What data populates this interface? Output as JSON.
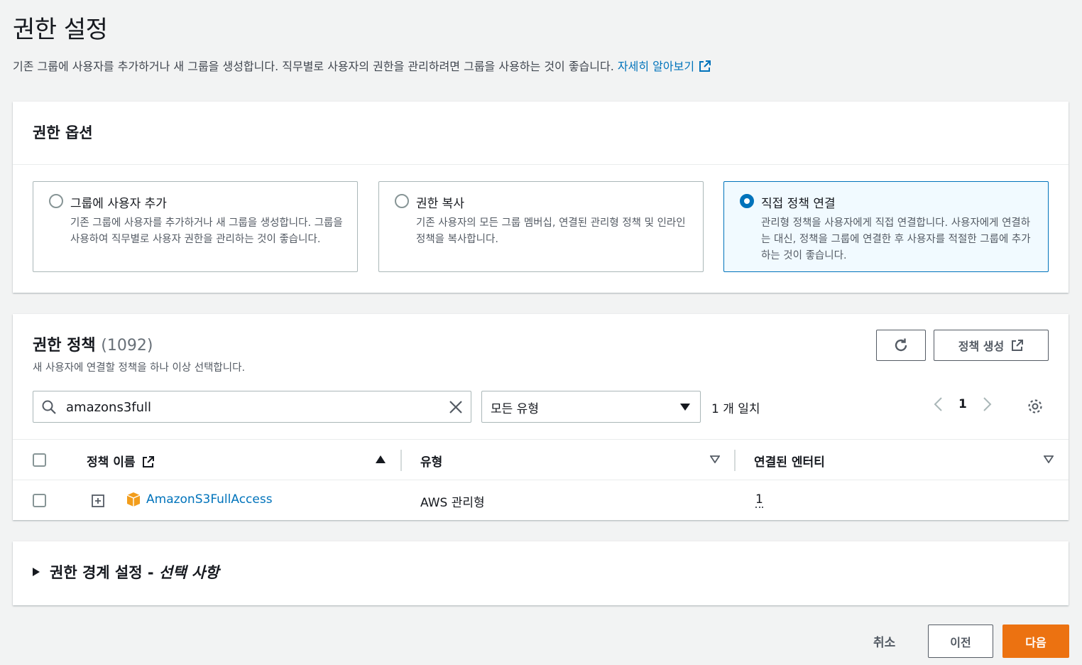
{
  "page": {
    "title": "권한 설정",
    "description": "기존 그룹에 사용자를 추가하거나 새 그룹을 생성합니다. 직무별로 사용자의 권한을 관리하려면 그룹을 사용하는 것이 좋습니다.",
    "learn_more": "자세히 알아보기"
  },
  "options": {
    "header": "권한 옵션",
    "items": [
      {
        "title": "그룹에 사용자 추가",
        "desc": "기존 그룹에 사용자를 추가하거나 새 그룹을 생성합니다. 그룹을 사용하여 직무별로 사용자 권한을 관리하는 것이 좋습니다.",
        "selected": false
      },
      {
        "title": "권한 복사",
        "desc": "기존 사용자의 모든 그룹 멤버십, 연결된 관리형 정책 및 인라인 정책을 복사합니다.",
        "selected": false
      },
      {
        "title": "직접 정책 연결",
        "desc": "관리형 정책을 사용자에게 직접 연결합니다. 사용자에게 연결하는 대신, 정책을 그룹에 연결한 후 사용자를 적절한 그룹에 추가하는 것이 좋습니다.",
        "selected": true
      }
    ]
  },
  "policies": {
    "title": "권한 정책",
    "count": "(1092)",
    "subtitle": "새 사용자에 연결할 정책을 하나 이상 선택합니다.",
    "create_label": "정책 생성",
    "search_value": "amazons3full",
    "filter_type": "모든 유형",
    "match_count": "1 개 일치",
    "page_number": "1",
    "columns": {
      "name": "정책 이름",
      "type": "유형",
      "entities": "연결된 엔터티"
    },
    "rows": [
      {
        "name": "AmazonS3FullAccess",
        "type": "AWS 관리형",
        "entities": "1"
      }
    ]
  },
  "boundary": {
    "title": "권한 경계 설정 - ",
    "optional": "선택 사항"
  },
  "footer": {
    "cancel": "취소",
    "previous": "이전",
    "next": "다음"
  },
  "colors": {
    "link": "#0073bb",
    "primary_button": "#ec7211",
    "selected_card_bg": "#f1faff"
  }
}
